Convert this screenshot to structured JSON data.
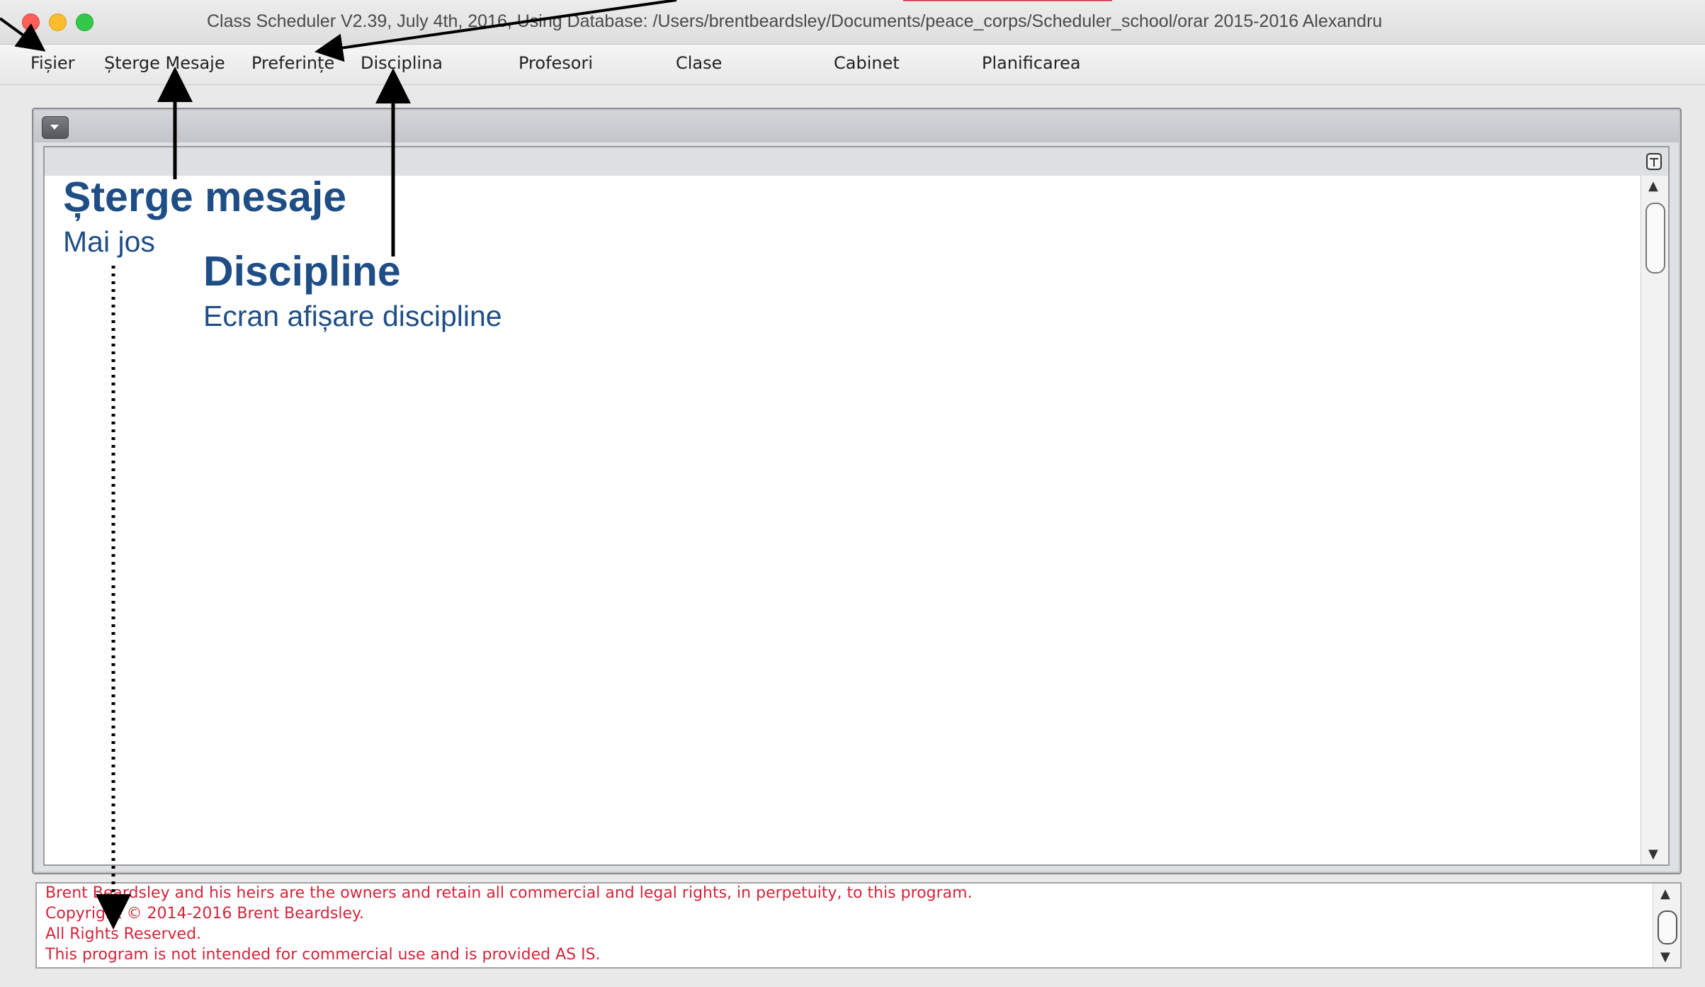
{
  "window": {
    "title": "Class Scheduler V2.39, July 4th, 2016, Using Database: /Users/brentbeardsley/Documents/peace_corps/Scheduler_school/orar 2015-2016 Alexandru"
  },
  "menu": {
    "items": [
      {
        "label": "Fișier"
      },
      {
        "label": "Șterge Mesaje"
      },
      {
        "label": "Preferințe"
      },
      {
        "label": "Disciplina"
      },
      {
        "label": "Profesori"
      },
      {
        "label": "Clase"
      },
      {
        "label": "Cabinet"
      },
      {
        "label": "Planificarea"
      }
    ]
  },
  "annotations": {
    "sterge": {
      "title": "Șterge mesaje",
      "subtitle": "Mai jos"
    },
    "discipline": {
      "title": "Discipline",
      "subtitle": "Ecran afișare discipline"
    }
  },
  "console": {
    "lines": [
      "Brent Beardsley and his heirs are the owners and retain all commercial and legal rights, in perpetuity, to this program.",
      "Copyright © 2014-2016 Brent Beardsley.",
      "All Rights Reserved.",
      "This program is not intended for commercial use and is provided AS IS."
    ]
  },
  "colors": {
    "annotation": "#1f4e86",
    "console_text": "#d4253b",
    "close": "#fc5f57",
    "minimize": "#fdbc2e",
    "zoom": "#34c84a"
  },
  "icons": {
    "collapse": "chevron-down-icon",
    "panel_corner": "panel-layout-icon",
    "scroll_up": "arrow-up-icon",
    "scroll_down": "arrow-down-icon"
  }
}
